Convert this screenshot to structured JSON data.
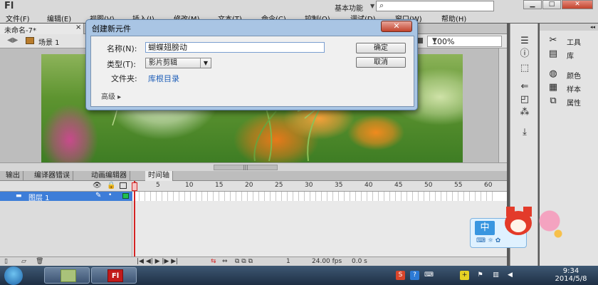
{
  "app": {
    "logo": "Fl",
    "workspace": "基本功能",
    "search_icon": "⌕",
    "window_buttons": [
      "▁",
      "□",
      "✕"
    ]
  },
  "menu": [
    "文件(F)",
    "编辑(E)",
    "视图(V)",
    "插入(I)",
    "修改(M)",
    "文本(T)",
    "命令(C)",
    "控制(O)",
    "调试(D)",
    "窗口(W)",
    "帮助(H)"
  ],
  "document_tab": {
    "label": "未命名-7*",
    "close": "×"
  },
  "scene": {
    "label": "场景 1",
    "zoom": "100%"
  },
  "dialog": {
    "title": "创建新元件",
    "close": "✕",
    "name_label": "名称(N):",
    "name_value": "蝴蝶翅膀动",
    "type_label": "类型(T):",
    "type_value": "影片剪辑",
    "folder_label": "文件夹:",
    "folder_value": "库根目录",
    "advanced_label": "高级 ▸",
    "ok": "确定",
    "cancel": "取消"
  },
  "right_panel": {
    "items": [
      {
        "icon": "tools-icon",
        "glyph": "✂",
        "label": "工具"
      },
      {
        "icon": "library-icon",
        "glyph": "▤",
        "label": "库"
      },
      {
        "icon": "color-icon",
        "glyph": "◍",
        "label": "颜色"
      },
      {
        "icon": "swatches-icon",
        "glyph": "▦",
        "label": "样本"
      },
      {
        "icon": "properties-icon",
        "glyph": "⧉",
        "label": "属性"
      }
    ]
  },
  "timeline": {
    "tabs": [
      "输出",
      "编译器错误",
      "动画编辑器",
      "时间轴"
    ],
    "active_tab": "时间轴",
    "frame_numbers": [
      "1",
      "5",
      "10",
      "15",
      "20",
      "25",
      "30",
      "35",
      "40",
      "45",
      "50",
      "55",
      "60"
    ],
    "layer_name": "图层 1",
    "status": {
      "frame": "1",
      "fps": "24.00 fps",
      "time": "0.0 s"
    }
  },
  "ime": {
    "label": "中"
  },
  "taskbar": {
    "clock_time": "9:34",
    "clock_date": "2014/5/8",
    "flash_label": "Fl"
  },
  "colors": {
    "accent_red": "#d42424",
    "layer_blue": "#3d7dd8",
    "dialog_frame": "#a9c5e4"
  }
}
